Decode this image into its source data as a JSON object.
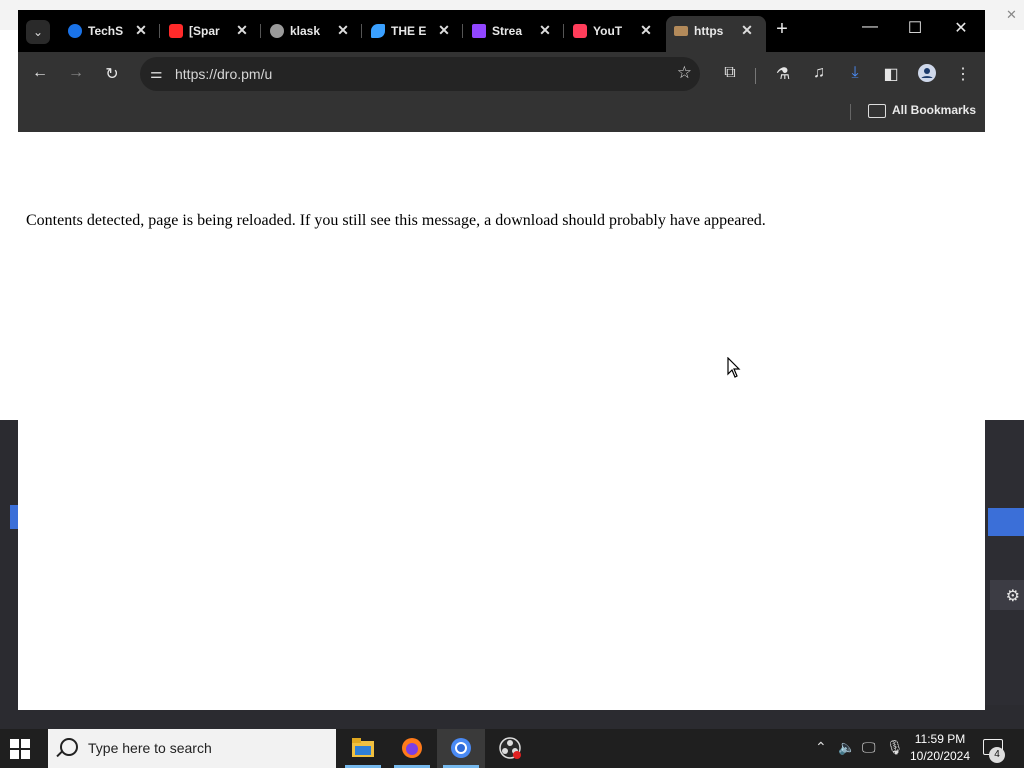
{
  "browser": {
    "tabs": [
      {
        "title": "TechS",
        "favicon_color": "#1a73e8"
      },
      {
        "title": "[Spar",
        "favicon_color": "#ff2a2a"
      },
      {
        "title": "klask",
        "favicon_color": "#9a9a9a"
      },
      {
        "title": "THE E",
        "favicon_color": "#3aa0ff"
      },
      {
        "title": "Strea",
        "favicon_color": "#9146ff"
      },
      {
        "title": "YouT",
        "favicon_color": "#ff3d5a"
      },
      {
        "title": "https",
        "favicon_color": "#b38a5a",
        "active": true
      }
    ],
    "address_url": "https://dro.pm/u",
    "bookmarks_label": "All Bookmarks",
    "icons": [
      "tab-search-icon",
      "back-icon",
      "forward-icon",
      "reload-icon",
      "site-info-icon",
      "star-icon",
      "extensions-icon",
      "labs-icon",
      "media-icon",
      "download-icon",
      "side-panel-icon",
      "profile-icon",
      "menu-icon",
      "folder-icon",
      "minimize-icon",
      "maximize-icon",
      "close-icon"
    ]
  },
  "page": {
    "message": "Contents detected, page is being reloaded. If you still see this message, a download should probably have appeared."
  },
  "taskbar": {
    "search_placeholder": "Type here to search",
    "time": "11:59 PM",
    "date": "10/20/2024",
    "notification_count": "4"
  },
  "colors": {
    "tabbar_bg": "#000000",
    "toolbar_bg": "#333333",
    "download_icon": "#4b8df8",
    "taskbar_bg": "#1f1f1f"
  }
}
